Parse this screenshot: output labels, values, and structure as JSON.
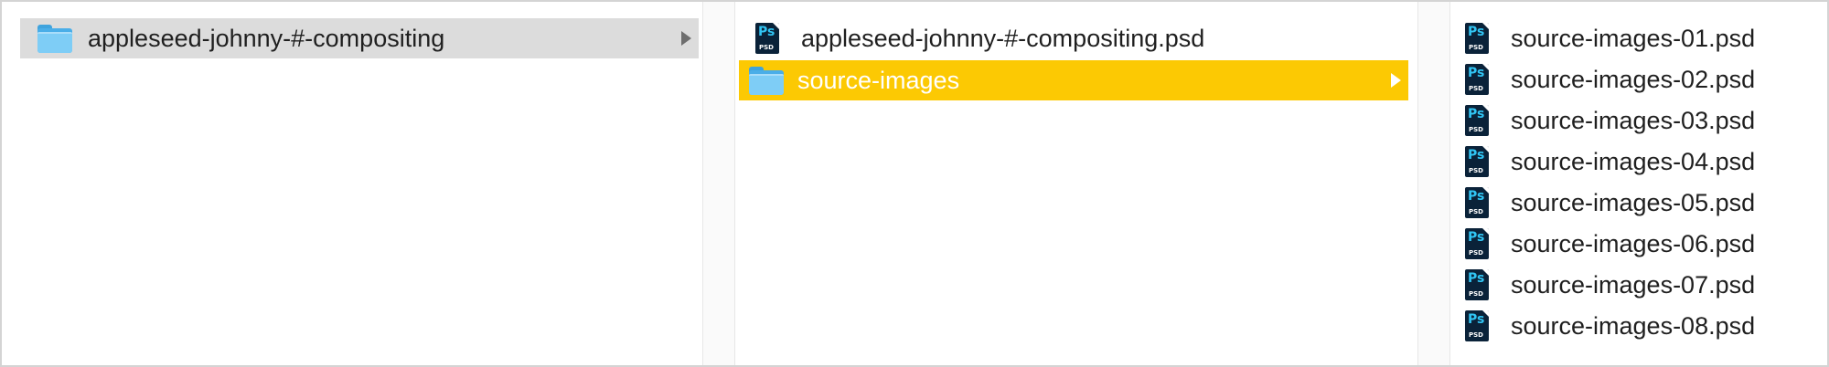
{
  "columns": [
    {
      "items": [
        {
          "label": "appleseed-johnny-#-compositing",
          "kind": "folder",
          "icon": "folder-icon",
          "selection": "path"
        }
      ]
    },
    {
      "items": [
        {
          "label": "appleseed-johnny-#-compositing.psd",
          "kind": "psd",
          "icon": "photoshop-file-icon"
        },
        {
          "label": "source-images",
          "kind": "folder",
          "icon": "folder-icon",
          "selection": "active"
        }
      ]
    },
    {
      "items": [
        {
          "label": "source-images-01.psd",
          "kind": "psd",
          "icon": "photoshop-file-icon"
        },
        {
          "label": "source-images-02.psd",
          "kind": "psd",
          "icon": "photoshop-file-icon"
        },
        {
          "label": "source-images-03.psd",
          "kind": "psd",
          "icon": "photoshop-file-icon"
        },
        {
          "label": "source-images-04.psd",
          "kind": "psd",
          "icon": "photoshop-file-icon"
        },
        {
          "label": "source-images-05.psd",
          "kind": "psd",
          "icon": "photoshop-file-icon"
        },
        {
          "label": "source-images-06.psd",
          "kind": "psd",
          "icon": "photoshop-file-icon"
        },
        {
          "label": "source-images-07.psd",
          "kind": "psd",
          "icon": "photoshop-file-icon"
        },
        {
          "label": "source-images-08.psd",
          "kind": "psd",
          "icon": "photoshop-file-icon"
        }
      ]
    }
  ],
  "psd_icon": {
    "badge": "Ps",
    "ext": "PSD"
  },
  "colors": {
    "active_selection": "#fcc903",
    "path_selection": "#dcdcdc",
    "folder": "#7ecdf6",
    "psd_icon_bg": "#0a2239",
    "psd_icon_text": "#31c5f4"
  }
}
